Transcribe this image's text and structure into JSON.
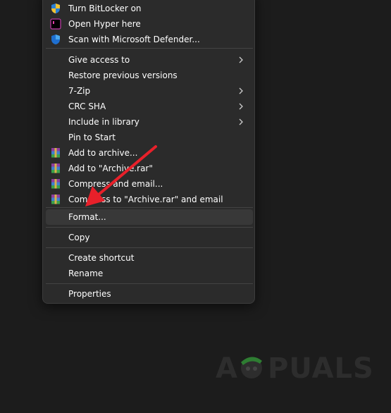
{
  "menu": {
    "items": [
      {
        "label": "Turn BitLocker on",
        "icon": "bitlocker-shield-icon"
      },
      {
        "label": "Open Hyper here",
        "icon": "hyper-terminal-icon"
      },
      {
        "label": "Scan with Microsoft Defender...",
        "icon": "defender-shield-icon"
      },
      {
        "label": "Give access to",
        "submenu": true
      },
      {
        "label": "Restore previous versions"
      },
      {
        "label": "7-Zip",
        "submenu": true
      },
      {
        "label": "CRC SHA",
        "submenu": true
      },
      {
        "label": "Include in library",
        "submenu": true
      },
      {
        "label": "Pin to Start"
      },
      {
        "label": "Add to archive...",
        "icon": "winrar-icon"
      },
      {
        "label": "Add to \"Archive.rar\"",
        "icon": "winrar-icon"
      },
      {
        "label": "Compress and email...",
        "icon": "winrar-icon"
      },
      {
        "label": "Compress to \"Archive.rar\" and email",
        "icon": "winrar-icon"
      },
      {
        "label": "Format...",
        "highlighted": true
      },
      {
        "label": "Copy"
      },
      {
        "label": "Create shortcut"
      },
      {
        "label": "Rename"
      },
      {
        "label": "Properties"
      }
    ]
  },
  "annotation": {
    "arrow_color": "#e8202a"
  },
  "watermark": {
    "text_left": "A",
    "text_right": "PUALS"
  },
  "colors": {
    "menu_bg": "#2b2b2b",
    "highlight": "#383838",
    "separator": "#444444"
  }
}
